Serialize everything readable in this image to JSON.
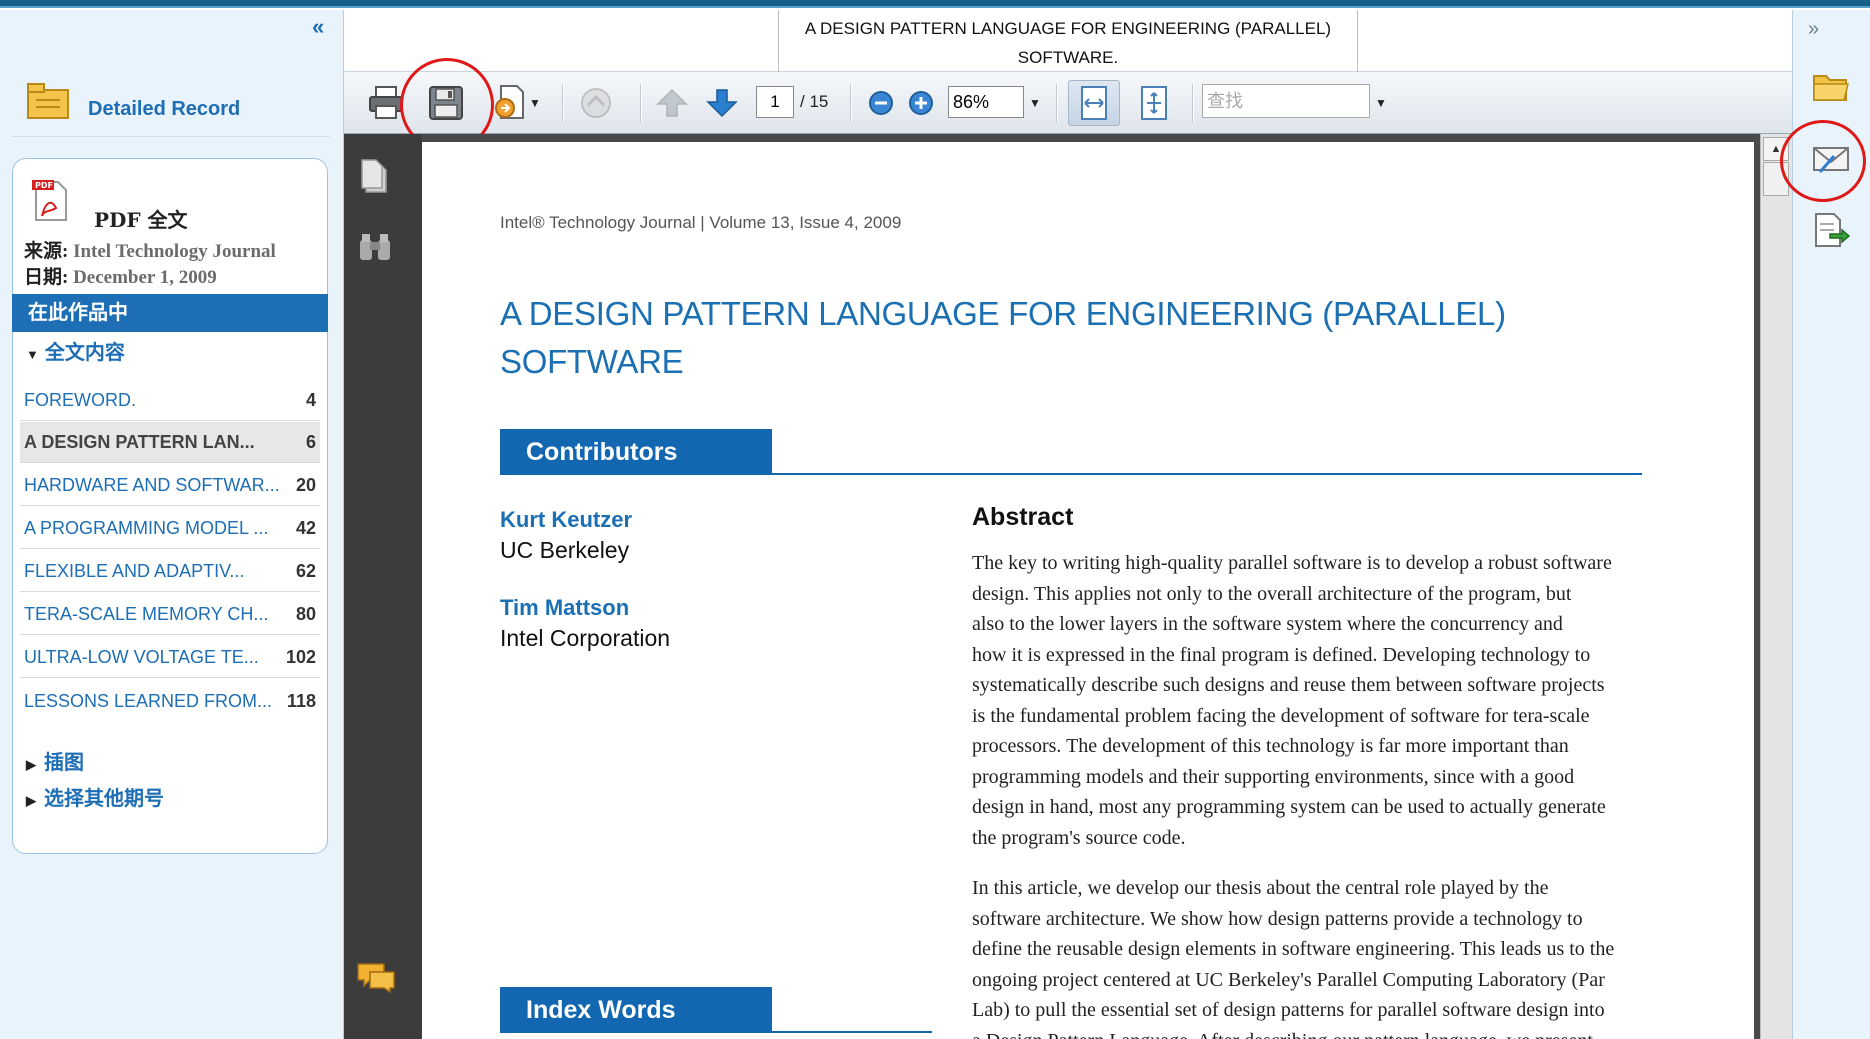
{
  "left_panel": {
    "collapse_glyph": "«",
    "record_title": "Detailed Record",
    "pdf_label": "PDF 全文",
    "source_label": "来源:",
    "source_value": "Intel Technology Journal",
    "date_label": "日期:",
    "date_value": "December 1, 2009",
    "in_work": "在此作品中",
    "toc_heading": "全文内容",
    "toc": [
      {
        "title": "FOREWORD.",
        "page": "4"
      },
      {
        "title": "A DESIGN PATTERN LAN...",
        "page": "6"
      },
      {
        "title": "HARDWARE AND SOFTWAR...",
        "page": "20"
      },
      {
        "title": "A PROGRAMMING MODEL ...",
        "page": "42"
      },
      {
        "title": "FLEXIBLE AND ADAPTIV...",
        "page": "62"
      },
      {
        "title": "TERA-SCALE MEMORY CH...",
        "page": "80"
      },
      {
        "title": "ULTRA-LOW VOLTAGE TE...",
        "page": "102"
      },
      {
        "title": "LESSONS LEARNED FROM...",
        "page": "118"
      }
    ],
    "figures": "插图",
    "other_issues": "选择其他期号"
  },
  "titlebar": {
    "line1": "A DESIGN PATTERN LANGUAGE FOR ENGINEERING (PARALLEL)",
    "line2": "SOFTWARE."
  },
  "toolbar": {
    "page_current": "1",
    "page_total": "/ 15",
    "zoom": "86%",
    "search_placeholder": "查找"
  },
  "document": {
    "journal_line": "Intel® Technology Journal | Volume 13, Issue 4, 2009",
    "title_line1": "A DESIGN PATTERN LANGUAGE FOR ENGINEERING (PARALLEL)",
    "title_line2": "SOFTWARE",
    "contributors_heading": "Contributors",
    "authors": [
      {
        "name": "Kurt Keutzer",
        "affiliation": "UC Berkeley"
      },
      {
        "name": "Tim Mattson",
        "affiliation": "Intel Corporation"
      }
    ],
    "abstract_heading": "Abstract",
    "abstract_p1": [
      "The key to writing high-quality parallel software is to develop a robust software",
      "design. This applies not only to the overall architecture of the program, but",
      "also to the lower layers in the software system where the concurrency and",
      "how it is expressed in the final program is defined. Developing technology to",
      "systematically describe such designs and reuse them between software projects",
      "is the fundamental problem facing the development of software for tera-scale",
      "processors. The development of this technology is far more important than",
      "programming models and their supporting environments, since with a good",
      "design in hand, most any programming system can be used to actually generate",
      "the program's source code."
    ],
    "abstract_p2": [
      "In this article, we develop our thesis about the central role played by the",
      "software architecture. We show how design patterns provide a technology to",
      "define the reusable design elements in software engineering. This leads us to the",
      "ongoing project centered at UC Berkeley's Parallel Computing Laboratory (Par",
      "Lab) to pull the essential set of design patterns for parallel software design into",
      "a Design Pattern Language. After describing our pattern language, we present"
    ],
    "index_words_heading": "Index Words"
  },
  "right_panel": {
    "collapse_glyph": "»"
  },
  "colors": {
    "accent": "#1d6eb5",
    "highlight_circle": "#e01818",
    "section_bar": "#1267b0"
  }
}
